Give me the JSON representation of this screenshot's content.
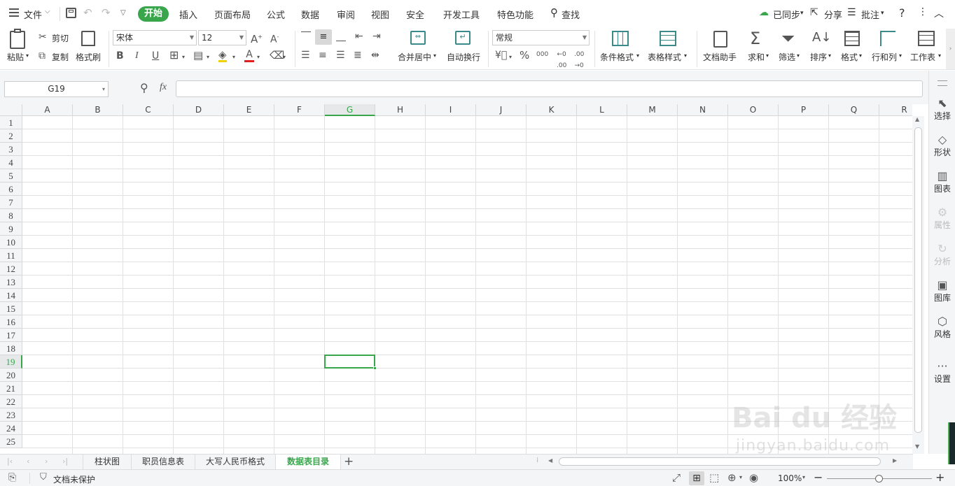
{
  "menu": {
    "file_label": "文件",
    "items": [
      "开始",
      "插入",
      "页面布局",
      "公式",
      "数据",
      "审阅",
      "视图",
      "安全",
      "开发工具",
      "特色功能"
    ],
    "search_label": "查找",
    "synced_label": "已同步",
    "share_label": "分享",
    "comment_label": "批注",
    "help": "?"
  },
  "ribbon": {
    "paste": "粘贴",
    "cut": "剪切",
    "copy": "复制",
    "format_painter": "格式刷",
    "font_name": "宋体",
    "font_size": "12",
    "bold": "B",
    "italic": "I",
    "underline": "U",
    "font_color_glyph": "A",
    "merge_center": "合并居中",
    "wrap_text": "自动换行",
    "number_format": "常规",
    "percent": "%",
    "thousands": "000",
    "cond_format": "条件格式",
    "table_style": "表格样式",
    "doc_helper": "文档助手",
    "sum": "求和",
    "filter": "筛选",
    "sort": "排序",
    "format": "格式",
    "rows_cols": "行和列",
    "worksheet": "工作表"
  },
  "formula_bar": {
    "name_box": "G19",
    "fx": "fx",
    "value": ""
  },
  "grid": {
    "columns": [
      "A",
      "B",
      "C",
      "D",
      "E",
      "F",
      "G",
      "H",
      "I",
      "J",
      "K",
      "L",
      "M",
      "N",
      "O",
      "P",
      "Q",
      "R"
    ],
    "rows": [
      "1",
      "2",
      "3",
      "4",
      "5",
      "6",
      "7",
      "8",
      "9",
      "10",
      "11",
      "12",
      "13",
      "14",
      "15",
      "16",
      "17",
      "18",
      "19",
      "20",
      "21",
      "22",
      "23",
      "24",
      "25"
    ],
    "selected_col": "G",
    "selected_row": "19"
  },
  "right_panel": {
    "items": [
      {
        "label": "选择",
        "icon": "cursor-icon",
        "enabled": true
      },
      {
        "label": "形状",
        "icon": "shape-icon",
        "enabled": true
      },
      {
        "label": "图表",
        "icon": "chart-icon",
        "enabled": true
      },
      {
        "label": "属性",
        "icon": "property-icon",
        "enabled": false
      },
      {
        "label": "分析",
        "icon": "analysis-icon",
        "enabled": false
      },
      {
        "label": "图库",
        "icon": "gallery-icon",
        "enabled": true
      },
      {
        "label": "风格",
        "icon": "style-icon",
        "enabled": true
      },
      {
        "label": "设置",
        "icon": "more-icon",
        "enabled": true
      }
    ]
  },
  "sheet_tabs": {
    "tabs": [
      "柱状图",
      "职员信息表",
      "大写人民币格式",
      "数据表目录"
    ],
    "active": "数据表目录",
    "add": "+"
  },
  "status_bar": {
    "protect_label": "文档未保护",
    "zoom": "100%",
    "zoom_out": "−",
    "zoom_in": "+"
  },
  "watermark": {
    "brand": "Bai du 经验",
    "url": "jingyan.baidu.com"
  },
  "colors": {
    "accent": "#3aa64c",
    "header_bg": "#f4f5f7",
    "grid_line": "#e0e0e0"
  }
}
